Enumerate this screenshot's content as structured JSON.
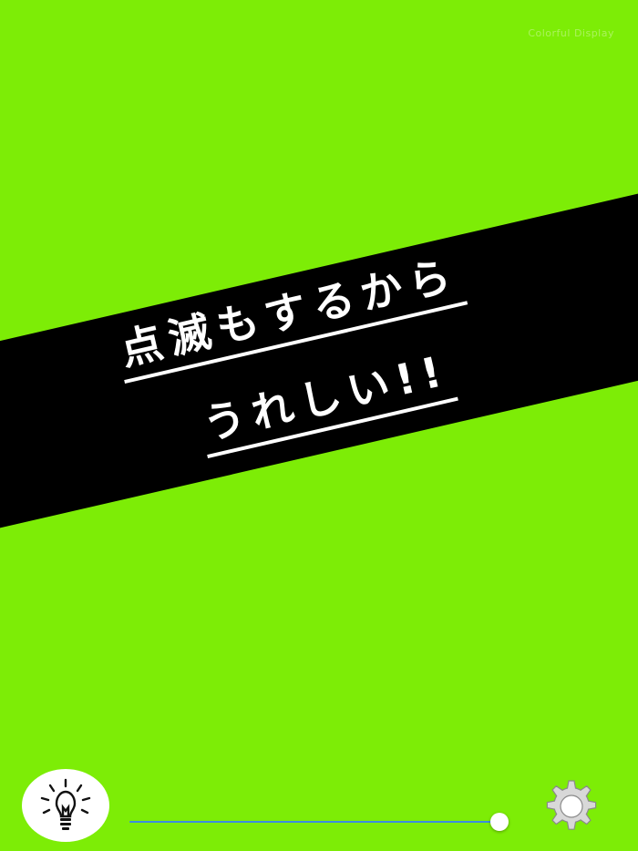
{
  "app": {
    "label": "Colorful Display"
  },
  "banner": {
    "line1": "点滅もするから",
    "line2": "うれしい!!"
  },
  "colors": {
    "background": "#7ded06",
    "banner": "#000000",
    "text": "#ffffff",
    "slider_track": "#3c8de0"
  },
  "controls": {
    "bulb_icon": "lightbulb-icon",
    "gear_icon": "gear-icon",
    "slider_value": 1.0
  }
}
